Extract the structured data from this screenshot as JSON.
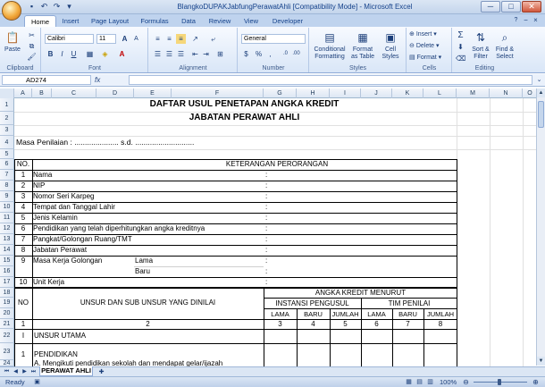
{
  "window": {
    "title": "BlangkoDUPAKJabfungPerawatAhli  [Compatibility Mode]  -  Microsoft Excel",
    "minimize": "─",
    "maximize": "□",
    "close": "✕"
  },
  "tabs": [
    "Home",
    "Insert",
    "Page Layout",
    "Formulas",
    "Data",
    "Review",
    "View",
    "Developer"
  ],
  "ribbon": {
    "clipboard": {
      "label": "Clipboard",
      "paste": "Paste"
    },
    "font": {
      "label": "Font",
      "name": "Calibri",
      "size": "11",
      "bold": "B",
      "italic": "I",
      "underline": "U"
    },
    "alignment": {
      "label": "Alignment"
    },
    "number": {
      "label": "Number",
      "format": "General",
      "currency": "$",
      "percent": "%",
      "comma": ","
    },
    "styles": {
      "label": "Styles",
      "conditional": "Conditional Formatting",
      "table": "Format as Table",
      "cell": "Cell Styles"
    },
    "cells": {
      "label": "Cells",
      "insert": "Insert",
      "delete": "Delete",
      "format": "Format"
    },
    "editing": {
      "label": "Editing",
      "sort": "Sort & Filter",
      "find": "Find & Select",
      "sigma": "Σ"
    }
  },
  "formula_bar": {
    "name_box": "AD274",
    "fx": "fx",
    "value": ""
  },
  "columns": [
    "A",
    "B",
    "C",
    "D",
    "E",
    "F",
    "G",
    "H",
    "I",
    "J",
    "K",
    "L",
    "M",
    "N",
    "O"
  ],
  "rows": [
    "1",
    "2",
    "3",
    "4",
    "5",
    "6",
    "7",
    "8",
    "9",
    "10",
    "11",
    "12",
    "13",
    "14",
    "15",
    "16",
    "17",
    "18",
    "19",
    "20",
    "21",
    "22",
    "23",
    "24"
  ],
  "sheet": {
    "title1": "DAFTAR USUL PENETAPAN ANGKA KREDIT",
    "title2": "JABATAN PERAWAT AHLI",
    "periode": "Masa Penilaian : ..................... s.d. ............................",
    "no_header": "NO.",
    "ket_header": "KETERANGAN PERORANGAN",
    "items": [
      {
        "no": "1",
        "label": "Nama"
      },
      {
        "no": "2",
        "label": "NIP"
      },
      {
        "no": "3",
        "label": "Nomor Seri Karpeg"
      },
      {
        "no": "4",
        "label": "Tempat dan Tanggal Lahir"
      },
      {
        "no": "5",
        "label": "Jenis Kelamin"
      },
      {
        "no": "6",
        "label": "Pendidikan yang telah diperhitungkan angka kreditnya"
      },
      {
        "no": "7",
        "label": "Pangkat/Golongan Ruang/TMT"
      },
      {
        "no": "8",
        "label": "Jabatan Perawat"
      },
      {
        "no": "9",
        "label": "Masa Kerja Golongan"
      },
      {
        "no": "10",
        "label": "Unit Kerja"
      }
    ],
    "colon": ":",
    "lama": "Lama",
    "baru": "Baru",
    "no2": "NO",
    "unsur_header": "UNSUR DAN SUB UNSUR YANG DINILAI",
    "angka_kredit": "ANGKA KREDIT MENURUT",
    "instansi": "INSTANSI PENGUSUL",
    "tim": "TIM PENILAI",
    "sub_cols": [
      "LAMA",
      "BARU",
      "JUMLAH",
      "LAMA",
      "BARU",
      "JUMLAH"
    ],
    "num_row": [
      "1",
      "2",
      "3",
      "4",
      "5",
      "6",
      "7",
      "8"
    ],
    "row22_no": "I",
    "row22_label": "UNSUR UTAMA",
    "row23_no": "1",
    "row23_label": "PENDIDIKAN",
    "row24_label": "A.  Mengikuti pendidikan sekolah dan mendapat gelar/ijazah"
  },
  "sheet_tab": "PERAWAT AHLI",
  "status": {
    "ready": "Ready",
    "zoom": "100%"
  }
}
